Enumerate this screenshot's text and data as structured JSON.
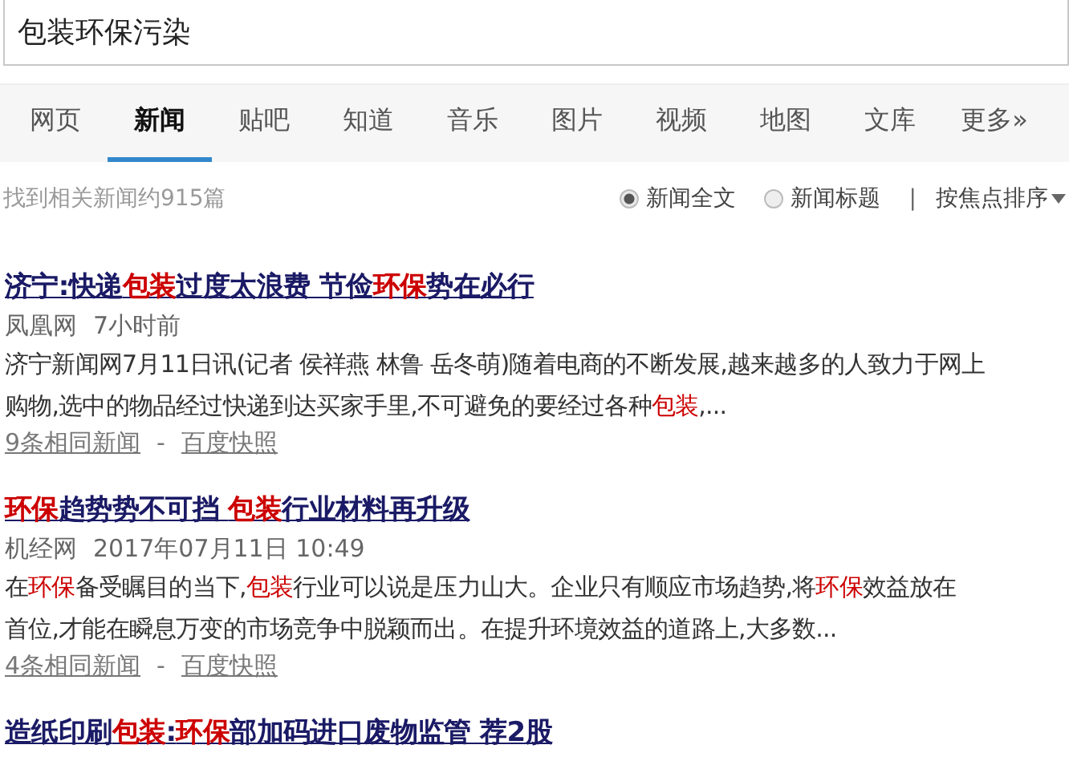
{
  "search": {
    "value": "包装环保污染"
  },
  "tabs": [
    {
      "label": "网页",
      "selected": false
    },
    {
      "label": "新闻",
      "selected": true
    },
    {
      "label": "贴吧",
      "selected": false
    },
    {
      "label": "知道",
      "selected": false
    },
    {
      "label": "音乐",
      "selected": false
    },
    {
      "label": "图片",
      "selected": false
    },
    {
      "label": "视频",
      "selected": false
    },
    {
      "label": "地图",
      "selected": false
    },
    {
      "label": "文库",
      "selected": false
    },
    {
      "label": "更多»",
      "selected": false
    }
  ],
  "result_count": "找到相关新闻约915篇",
  "scope_options": [
    {
      "label": "新闻全文",
      "selected": true
    },
    {
      "label": "新闻标题",
      "selected": false
    }
  ],
  "separator": "|",
  "sort": {
    "label": "按焦点排序"
  },
  "results": [
    {
      "title": [
        {
          "text": "济宁:快递",
          "highlight": false
        },
        {
          "text": "包装",
          "highlight": true
        },
        {
          "text": "过度太浪费 节俭",
          "highlight": false
        },
        {
          "text": "环保",
          "highlight": true
        },
        {
          "text": "势在必行",
          "highlight": false
        }
      ],
      "source": "凤凰网",
      "time": "7小时前",
      "snippet": [
        [
          {
            "text": "济宁新闻网7月11日讯(记者 侯祥燕 林鲁 岳冬萌)随着电商的不断发展,越来越多的人致力于网上",
            "highlight": false
          }
        ],
        [
          {
            "text": "购物,选中的物品经过快递到达买家手里,不可避免的要经过各种",
            "highlight": false
          },
          {
            "text": "包装",
            "highlight": true
          },
          {
            "text": ",...",
            "highlight": false
          }
        ]
      ],
      "same_news": "9条相同新闻",
      "dash": "-",
      "snapshot": "百度快照"
    },
    {
      "title": [
        {
          "text": "环保",
          "highlight": true
        },
        {
          "text": "趋势势不可挡 ",
          "highlight": false
        },
        {
          "text": "包装",
          "highlight": true
        },
        {
          "text": "行业材料再升级",
          "highlight": false
        }
      ],
      "source": "机经网",
      "time": "2017年07月11日 10:49",
      "snippet": [
        [
          {
            "text": "在",
            "highlight": false
          },
          {
            "text": "环保",
            "highlight": true
          },
          {
            "text": "备受瞩目的当下,",
            "highlight": false
          },
          {
            "text": "包装",
            "highlight": true
          },
          {
            "text": "行业可以说是压力山大。企业只有顺应市场趋势,将",
            "highlight": false
          },
          {
            "text": "环保",
            "highlight": true
          },
          {
            "text": "效益放在",
            "highlight": false
          }
        ],
        [
          {
            "text": "首位,才能在瞬息万变的市场竞争中脱颖而出。在提升环境效益的道路上,大多数...",
            "highlight": false
          }
        ]
      ],
      "same_news": "4条相同新闻",
      "dash": "-",
      "snapshot": "百度快照"
    },
    {
      "title": [
        {
          "text": "造纸印刷",
          "highlight": false
        },
        {
          "text": "包装",
          "highlight": true
        },
        {
          "text": ":",
          "highlight": false
        },
        {
          "text": "环保",
          "highlight": true
        },
        {
          "text": "部加码进口废物监管 荐2股",
          "highlight": false
        }
      ]
    }
  ]
}
